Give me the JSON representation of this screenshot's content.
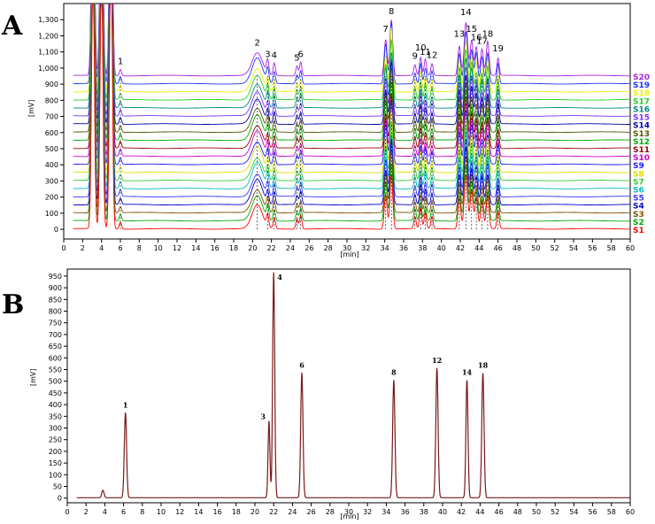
{
  "figure": {
    "panel_a_letter": "A",
    "panel_b_letter": "B"
  },
  "chart_data": [
    {
      "type": "line",
      "panel": "A",
      "xlabel": "[min]",
      "ylabel": "[mV]",
      "xlim": [
        0,
        60
      ],
      "ylim": [
        -60,
        1400
      ],
      "x_ticks": [
        0,
        2,
        4,
        6,
        8,
        10,
        12,
        14,
        16,
        18,
        20,
        22,
        24,
        26,
        28,
        30,
        32,
        34,
        36,
        38,
        40,
        42,
        44,
        46,
        48,
        50,
        52,
        54,
        56,
        58,
        60
      ],
      "x_tick_labels": [
        "0",
        "2",
        "4",
        "6",
        "8",
        "10",
        "12",
        "14",
        "16",
        "18",
        "20",
        "22",
        "24",
        "26",
        "28",
        "30",
        "32",
        "34",
        "36",
        "38",
        "40",
        "42",
        "44",
        "46",
        "48",
        "50",
        "52",
        "54",
        "56",
        "58",
        "60"
      ],
      "y_ticks": [
        0,
        100,
        200,
        300,
        400,
        500,
        600,
        700,
        800,
        900,
        1000,
        1100,
        1200,
        1300
      ],
      "y_tick_labels": [
        "0",
        "100",
        "200",
        "300",
        "400",
        "500",
        "600",
        "700",
        "800",
        "900",
        "1,000",
        "1,100",
        "1,200",
        "1,300"
      ],
      "grid": false,
      "legend_placement": "right",
      "stack_offset_mV": 50,
      "series": [
        {
          "name": "S1",
          "color": "#ff0000"
        },
        {
          "name": "S2",
          "color": "#00aa00"
        },
        {
          "name": "S3",
          "color": "#805000"
        },
        {
          "name": "S4",
          "color": "#0000cc"
        },
        {
          "name": "S5",
          "color": "#3333ff"
        },
        {
          "name": "S6",
          "color": "#00bbbb"
        },
        {
          "name": "S7",
          "color": "#33cc33"
        },
        {
          "name": "S8",
          "color": "#dddd00"
        },
        {
          "name": "S9",
          "color": "#1a1aff"
        },
        {
          "name": "S10",
          "color": "#cc00cc"
        },
        {
          "name": "S11",
          "color": "#990000"
        },
        {
          "name": "S12",
          "color": "#00aa00"
        },
        {
          "name": "S13",
          "color": "#555500"
        },
        {
          "name": "S14",
          "color": "#0000aa"
        },
        {
          "name": "S15",
          "color": "#7733ff"
        },
        {
          "name": "S16",
          "color": "#008888"
        },
        {
          "name": "S17",
          "color": "#22cc22"
        },
        {
          "name": "S18",
          "color": "#eeee00"
        },
        {
          "name": "S19",
          "color": "#1a33ff"
        },
        {
          "name": "S20",
          "color": "#aa22dd"
        }
      ],
      "peaks": [
        {
          "label": "",
          "rt": 3.1,
          "height": 1700,
          "width": 0.15
        },
        {
          "label": "",
          "rt": 4.0,
          "height": 1700,
          "width": 0.15
        },
        {
          "label": "",
          "rt": 5.0,
          "height": 1700,
          "width": 0.15
        },
        {
          "label": "1",
          "rt": 6.0,
          "height": 40,
          "width": 0.12
        },
        {
          "label": "2",
          "rt": 20.5,
          "height": 150,
          "width": 0.55
        },
        {
          "label": "3",
          "rt": 21.6,
          "height": 80,
          "width": 0.12
        },
        {
          "label": "4",
          "rt": 22.3,
          "height": 75,
          "width": 0.12
        },
        {
          "label": "5",
          "rt": 24.7,
          "height": 60,
          "width": 0.12
        },
        {
          "label": "6",
          "rt": 25.1,
          "height": 80,
          "width": 0.12
        },
        {
          "label": "7",
          "rt": 34.1,
          "height": 230,
          "width": 0.15
        },
        {
          "label": "8",
          "rt": 34.7,
          "height": 370,
          "width": 0.15
        },
        {
          "label": "9",
          "rt": 37.2,
          "height": 70,
          "width": 0.12
        },
        {
          "label": "10",
          "rt": 37.8,
          "height": 120,
          "width": 0.12
        },
        {
          "label": "11",
          "rt": 38.3,
          "height": 95,
          "width": 0.12
        },
        {
          "label": "12",
          "rt": 39.0,
          "height": 75,
          "width": 0.12
        },
        {
          "label": "13",
          "rt": 41.9,
          "height": 200,
          "width": 0.15
        },
        {
          "label": "14",
          "rt": 42.6,
          "height": 330,
          "width": 0.18
        },
        {
          "label": "15",
          "rt": 43.2,
          "height": 230,
          "width": 0.15
        },
        {
          "label": "16",
          "rt": 43.7,
          "height": 180,
          "width": 0.15
        },
        {
          "label": "17",
          "rt": 44.3,
          "height": 160,
          "width": 0.15
        },
        {
          "label": "18",
          "rt": 44.9,
          "height": 200,
          "width": 0.15
        },
        {
          "label": "19",
          "rt": 46.0,
          "height": 115,
          "width": 0.12
        }
      ]
    },
    {
      "type": "line",
      "panel": "B",
      "xlabel": "[min]",
      "ylabel": "[mV]",
      "xlim": [
        0,
        60
      ],
      "ylim": [
        -20,
        980
      ],
      "x_ticks": [
        0,
        2,
        4,
        6,
        8,
        10,
        12,
        14,
        16,
        18,
        20,
        22,
        24,
        26,
        28,
        30,
        32,
        34,
        36,
        38,
        40,
        42,
        44,
        46,
        48,
        50,
        52,
        54,
        56,
        58,
        60
      ],
      "x_tick_labels": [
        "0",
        "2",
        "4",
        "6",
        "8",
        "10",
        "12",
        "14",
        "16",
        "18",
        "20",
        "22",
        "24",
        "26",
        "28",
        "30",
        "32",
        "34",
        "36",
        "38",
        "40",
        "42",
        "44",
        "46",
        "48",
        "50",
        "52",
        "54",
        "56",
        "58",
        "60"
      ],
      "y_ticks": [
        0,
        50,
        100,
        150,
        200,
        250,
        300,
        350,
        400,
        450,
        500,
        550,
        600,
        650,
        700,
        750,
        800,
        850,
        900,
        950
      ],
      "y_tick_labels": [
        "0",
        "50",
        "100",
        "150",
        "200",
        "250",
        "300",
        "350",
        "400",
        "450",
        "500",
        "550",
        "600",
        "650",
        "700",
        "750",
        "800",
        "850",
        "900",
        "950"
      ],
      "grid": false,
      "line_color": "#7a1a1a",
      "peaks": [
        {
          "label": "",
          "rt": 3.8,
          "height": 32,
          "width": 0.12
        },
        {
          "label": "1",
          "rt": 6.2,
          "height": 365,
          "width": 0.12
        },
        {
          "label": "3",
          "rt": 21.5,
          "height": 330,
          "width": 0.1
        },
        {
          "label": "4",
          "rt": 22.0,
          "height": 965,
          "width": 0.11
        },
        {
          "label": "6",
          "rt": 25.0,
          "height": 535,
          "width": 0.12
        },
        {
          "label": "8",
          "rt": 34.8,
          "height": 505,
          "width": 0.12
        },
        {
          "label": "12",
          "rt": 39.4,
          "height": 555,
          "width": 0.12
        },
        {
          "label": "14",
          "rt": 42.6,
          "height": 505,
          "width": 0.11
        },
        {
          "label": "18",
          "rt": 44.3,
          "height": 535,
          "width": 0.12
        }
      ]
    }
  ]
}
